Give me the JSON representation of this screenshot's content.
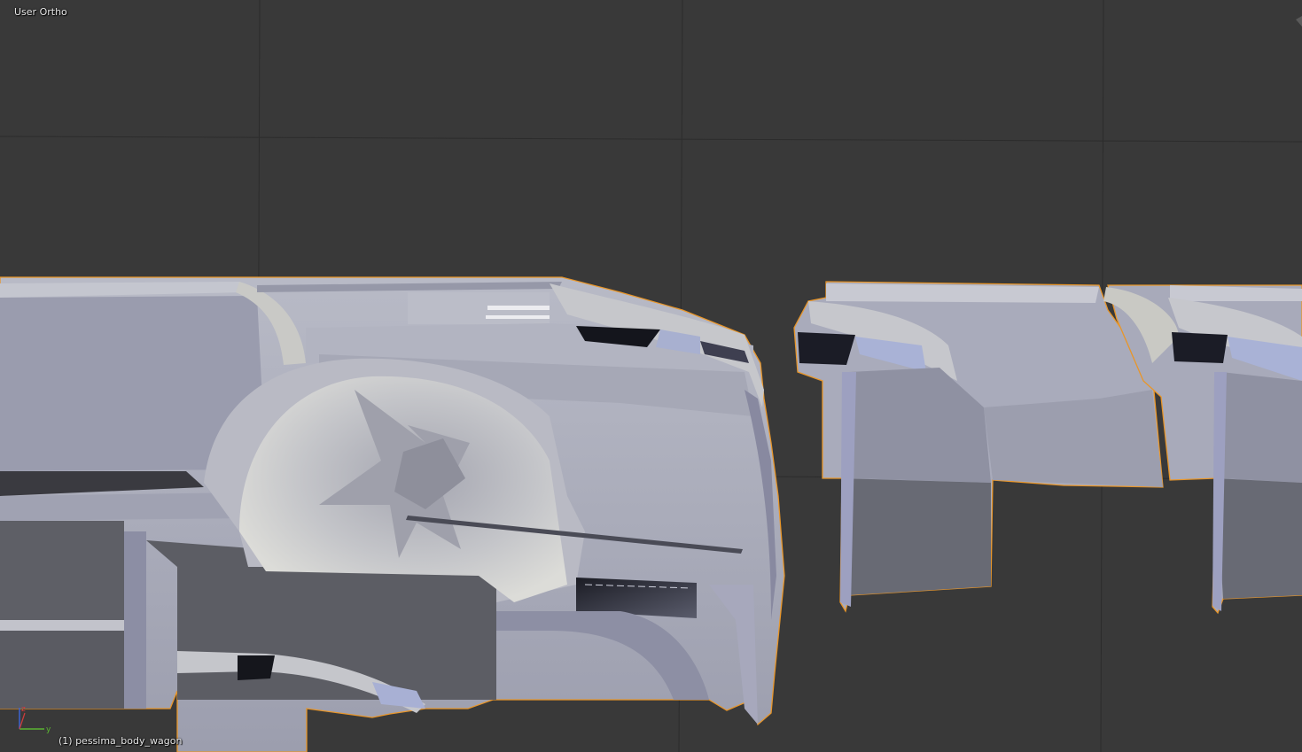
{
  "viewport": {
    "view_label": "User Ortho",
    "object_label": "(1) pessima_body_wagon"
  },
  "axis_gizmo": {
    "x_axis": "x",
    "y_axis": "y",
    "z_axis": "z",
    "x_color": "#d23c3c",
    "y_color": "#5ab432",
    "z_color": "#3c64d2"
  },
  "colors": {
    "background": "#393939",
    "grid": "#2d2d2d",
    "selection_outline": "#e8962a",
    "mesh_light": "#aeb0bd",
    "mesh_mid": "#8c8ea0",
    "mesh_dark": "#6c6e80",
    "mesh_shadow": "#1a1b22"
  }
}
